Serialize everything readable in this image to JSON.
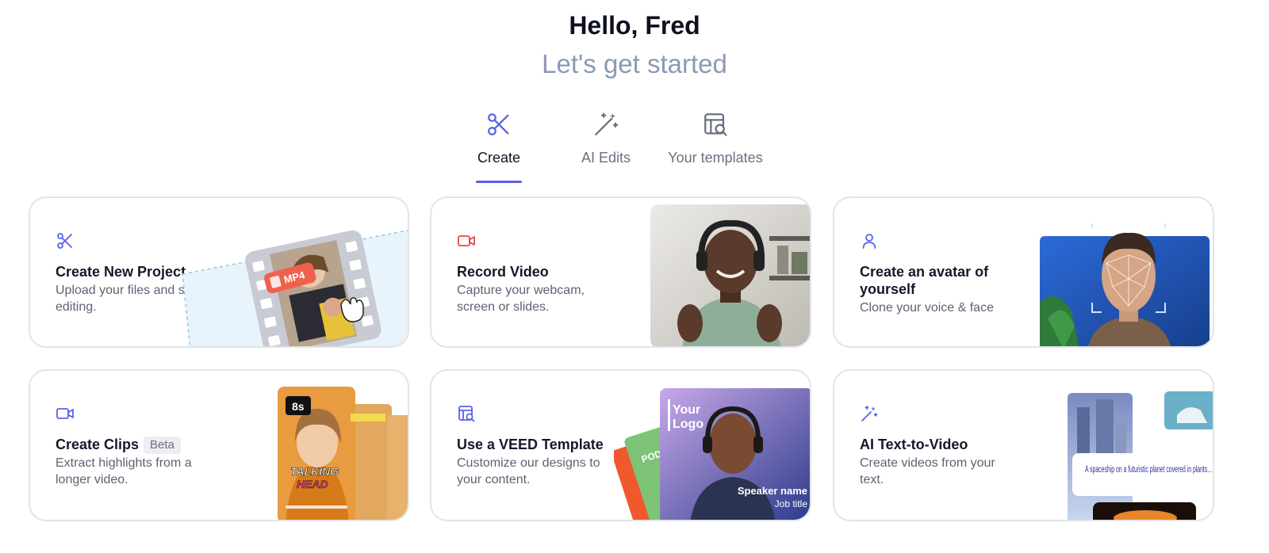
{
  "header": {
    "greeting": "Hello, Fred",
    "subtitle": "Let's get started"
  },
  "tabs": [
    {
      "label": "Create",
      "icon": "scissors-icon",
      "active": true
    },
    {
      "label": "AI Edits",
      "icon": "magic-wand-icon",
      "active": false
    },
    {
      "label": "Your templates",
      "icon": "template-search-icon",
      "active": false
    }
  ],
  "cards": [
    {
      "title": "Create New Project",
      "description": "Upload your files and start editing.",
      "icon": "scissors-icon",
      "badge": "MP4"
    },
    {
      "title": "Record Video",
      "description": "Capture your webcam, screen or slides.",
      "icon": "video-camera-icon"
    },
    {
      "title": "Create an avatar of yourself",
      "description": "Clone your voice & face",
      "icon": "person-icon"
    },
    {
      "title": "Create Clips",
      "beta": "Beta",
      "description": "Extract highlights from a longer video.",
      "icon": "video-camera-icon",
      "duration_badge": "8s",
      "caption_1": "TALKING",
      "caption_2": "HEAD"
    },
    {
      "title": "Use a VEED Template",
      "description": "Customize our designs to your content.",
      "icon": "template-search-icon",
      "logo_text_1": "Your",
      "logo_text_2": "Logo",
      "speaker_name": "Speaker name",
      "job_title": "Job title",
      "side_text": "PODC"
    },
    {
      "title": "AI Text-to-Video",
      "description": "Create videos from your text.",
      "icon": "sparkle-wand-icon",
      "prompt": "A spaceship on a futuristic planet covered in plants..."
    }
  ],
  "colors": {
    "accent": "#5a62e6",
    "record": "#e5484d",
    "heading": "#0d1020",
    "muted": "#8b9ab3"
  }
}
